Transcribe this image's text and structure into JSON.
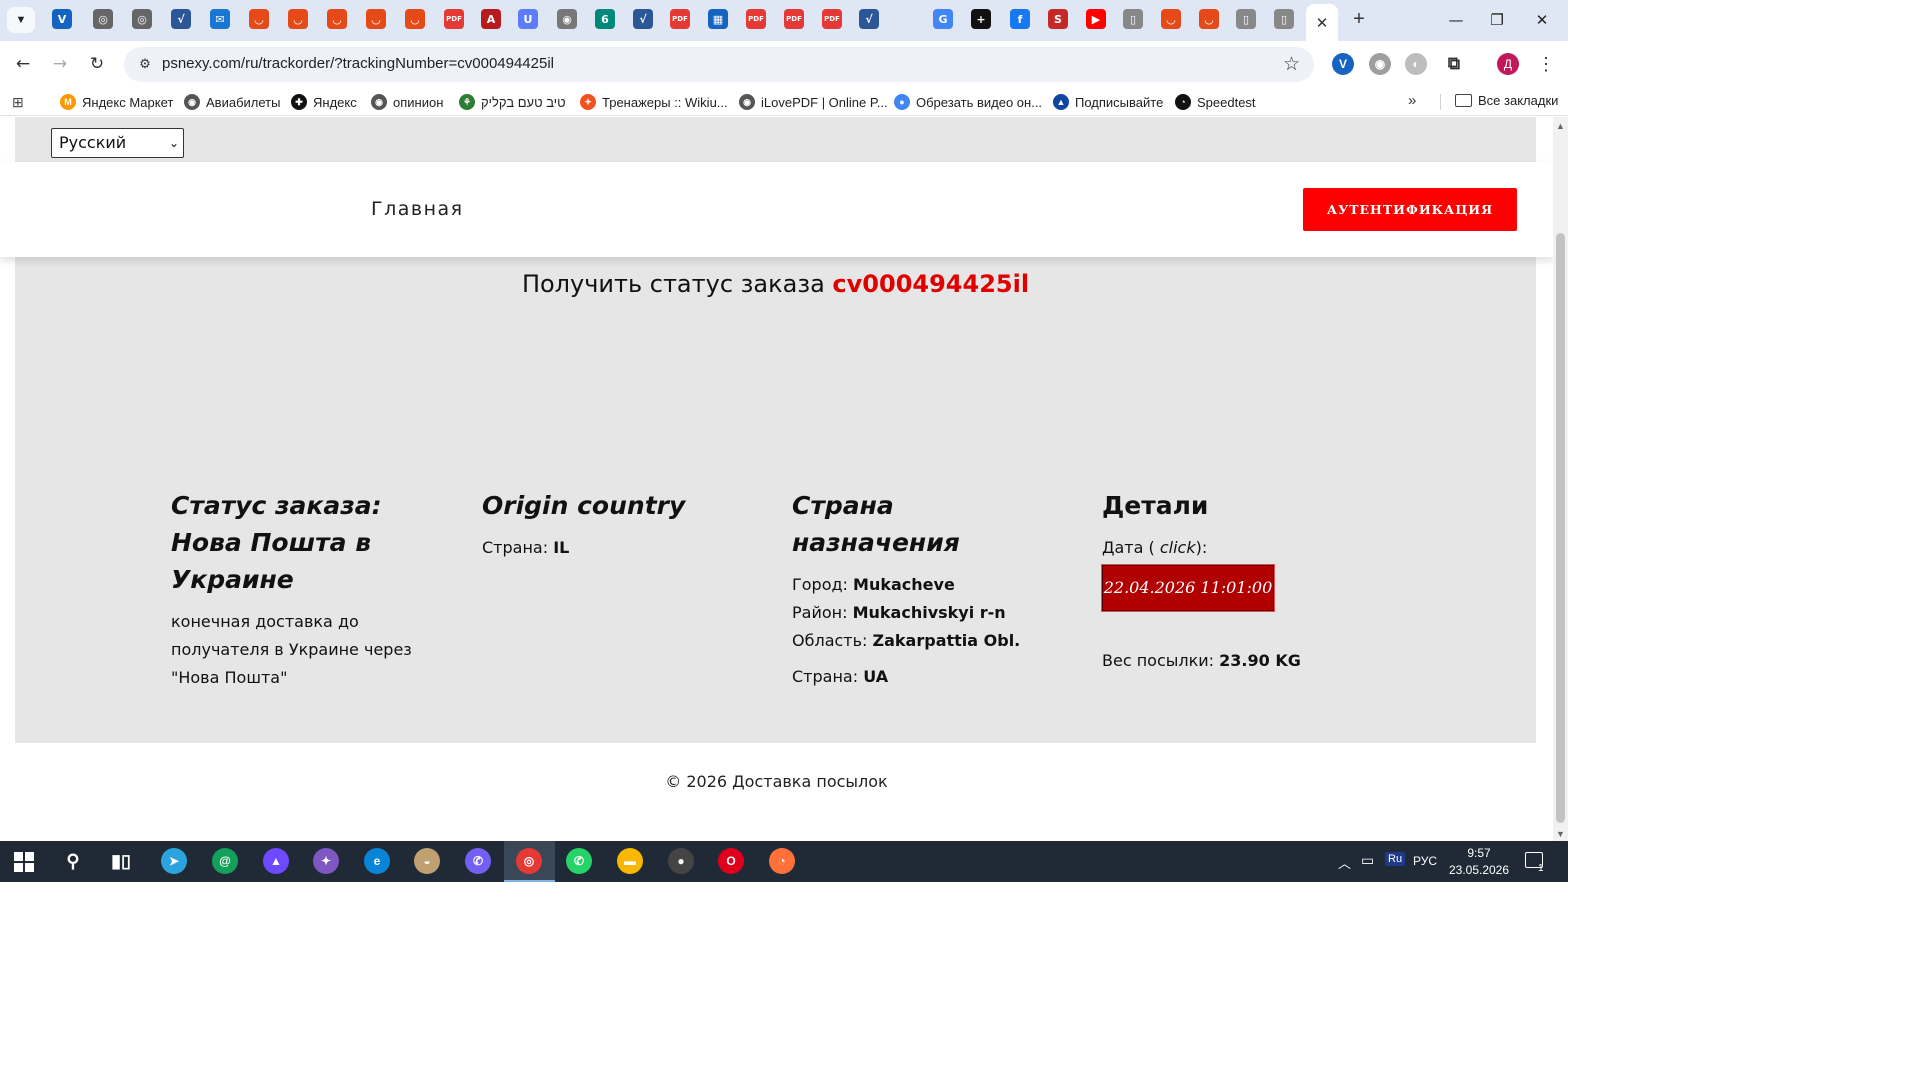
{
  "browser": {
    "url": "psnexy.com/ru/trackorder/?trackingNumber=cv000494425il",
    "active_tab_close": "✕",
    "new_tab": "+",
    "window_controls": {
      "minimize": "—",
      "restore": "❐",
      "close": "✕"
    },
    "tab_icons": [
      {
        "name": "verify-tab-icon",
        "color": "#1565c0",
        "glyph": "V"
      },
      {
        "name": "chrome-tab-icon",
        "color": "#666666",
        "glyph": "◎"
      },
      {
        "name": "chrome-tab-icon-2",
        "color": "#666666",
        "glyph": "◎"
      },
      {
        "name": "check-tab-icon",
        "color": "#2b5797",
        "glyph": "√"
      },
      {
        "name": "mail-tab-icon",
        "color": "#1976d2",
        "glyph": "✉"
      },
      {
        "name": "shield-tab-icon",
        "color": "#e64a19",
        "glyph": "◡"
      },
      {
        "name": "shield-tab-icon-2",
        "color": "#e64a19",
        "glyph": "◡"
      },
      {
        "name": "shield-tab-icon-3",
        "color": "#e64a19",
        "glyph": "◡"
      },
      {
        "name": "shield-tab-icon-4",
        "color": "#e64a19",
        "glyph": "◡"
      },
      {
        "name": "shield-tab-icon-5",
        "color": "#e64a19",
        "glyph": "◡"
      },
      {
        "name": "pdf-tab-icon",
        "color": "#e53935",
        "glyph": "PDF"
      },
      {
        "name": "acrobat-tab-icon",
        "color": "#b71c1c",
        "glyph": "A"
      },
      {
        "name": "u-tab-icon",
        "color": "#5c7cfa",
        "glyph": "U"
      },
      {
        "name": "globe-tab-icon",
        "color": "#777777",
        "glyph": "◉"
      },
      {
        "name": "six-tab-icon",
        "color": "#00897b",
        "glyph": "6"
      },
      {
        "name": "check-tab-icon-2",
        "color": "#2b5797",
        "glyph": "√"
      },
      {
        "name": "pdf-tab-icon-2",
        "color": "#e53935",
        "glyph": "PDF"
      },
      {
        "name": "building-tab-icon",
        "color": "#1565c0",
        "glyph": "▦"
      },
      {
        "name": "pdf-tab-icon-3",
        "color": "#e53935",
        "glyph": "PDF"
      },
      {
        "name": "pdf-tab-icon-4",
        "color": "#e53935",
        "glyph": "PDF"
      },
      {
        "name": "pdf-tab-icon-5",
        "color": "#e53935",
        "glyph": "PDF"
      },
      {
        "name": "check-tab-icon-3",
        "color": "#2b5797",
        "glyph": "√"
      },
      {
        "name": "translate-tab-icon",
        "color": "#4285f4",
        "glyph": "G"
      },
      {
        "name": "plus-tab-icon",
        "color": "#111111",
        "glyph": "+"
      },
      {
        "name": "facebook-tab-icon",
        "color": "#1877f2",
        "glyph": "f"
      },
      {
        "name": "scribd-tab-icon",
        "color": "#c62828",
        "glyph": "S"
      },
      {
        "name": "youtube-tab-icon",
        "color": "#ff0000",
        "glyph": "▶"
      },
      {
        "name": "doc-tab-icon",
        "color": "#888888",
        "glyph": "▯"
      },
      {
        "name": "shield-tab-icon-6",
        "color": "#e64a19",
        "glyph": "◡"
      },
      {
        "name": "shield-tab-icon-7",
        "color": "#e64a19",
        "glyph": "◡"
      },
      {
        "name": "doc-tab-icon-2",
        "color": "#888888",
        "glyph": "▯"
      },
      {
        "name": "doc-tab-icon-3",
        "color": "#888888",
        "glyph": "▯"
      }
    ],
    "profile_initial": "Д",
    "bookmarks": [
      {
        "label": "Яндекс Маркет",
        "color": "#ff9800",
        "glyph": "M"
      },
      {
        "label": "Авиабилеты",
        "color": "#555555",
        "glyph": "◉"
      },
      {
        "label": "Яндекс",
        "color": "#111111",
        "glyph": "✚"
      },
      {
        "label": "опинион",
        "color": "#555555",
        "glyph": "◉"
      },
      {
        "label": "טיב טעם בקליק",
        "color": "#2e7d32",
        "glyph": "⚘"
      },
      {
        "label": "Тренажеры :: Wikiu...",
        "color": "#f4511e",
        "glyph": "✦"
      },
      {
        "label": "iLovePDF | Online P...",
        "color": "#555555",
        "glyph": "◉"
      },
      {
        "label": "Обрезать видео он...",
        "color": "#4285f4",
        "glyph": "●"
      },
      {
        "label": "Подписывайте",
        "color": "#0d47a1",
        "glyph": "▲"
      },
      {
        "label": "Speedtest",
        "color": "#111111",
        "glyph": "◔"
      }
    ],
    "all_bookmarks": "Все закладки"
  },
  "page": {
    "language_select": "Русский",
    "nav_home": "Главная",
    "auth_button": "АУТЕНТИФИКАЦИЯ",
    "status_heading_prefix": "Получить статус заказа ",
    "tracking_number": "cv000494425il",
    "status": {
      "title": "Статус заказа: Нова Пошта в Украине",
      "description": "конечная доставка до получателя в Украине через \"Нова Пошта\""
    },
    "origin": {
      "title": "Origin country",
      "country_label": "Страна: ",
      "country_value": "IL"
    },
    "destination": {
      "title": "Страна назначения",
      "city_label": "Город: ",
      "city_value": "Mukacheve",
      "district_label": "Район: ",
      "district_value": "Mukachivskyi r-n",
      "region_label": "Область: ",
      "region_value": "Zakarpattia Obl.",
      "country_label": "Страна: ",
      "country_value": "UA"
    },
    "details": {
      "title": "Детали",
      "date_label_prefix": "Дата ( ",
      "date_label_click": "click",
      "date_label_suffix": "):",
      "date_value": "22.04.2026 11:01:00",
      "weight_label": "Вес посылки: ",
      "weight_value": "23.90 KG"
    },
    "footer": "© 2026 Доставка посылок",
    "accent_color": "#ff0000",
    "date_button_color": "#b00000"
  },
  "taskbar": {
    "apps": [
      {
        "name": "search-taskbar-icon",
        "color": "transparent",
        "glyph": "⚲"
      },
      {
        "name": "task-view-icon",
        "color": "transparent",
        "glyph": "▮▯"
      },
      {
        "name": "telegram-taskbar-icon",
        "color": "#2aa3df",
        "glyph": "➤"
      },
      {
        "name": "mail-ru-agent-icon",
        "color": "#14a05b",
        "glyph": "@"
      },
      {
        "name": "proton-vpn-icon",
        "color": "#6d4aff",
        "glyph": "▲"
      },
      {
        "name": "copilot-taskbar-icon",
        "color": "#7e57c2",
        "glyph": "✦"
      },
      {
        "name": "edge-taskbar-icon",
        "color": "#0a84d6",
        "glyph": "e"
      },
      {
        "name": "photos-taskbar-icon",
        "color": "#c0a070",
        "glyph": "◒"
      },
      {
        "name": "viber-taskbar-icon",
        "color": "#7360f2",
        "glyph": "✆"
      },
      {
        "name": "chrome-taskbar-icon",
        "color": "#e53935",
        "glyph": "◎"
      },
      {
        "name": "whatsapp-taskbar-icon",
        "color": "#25d366",
        "glyph": "✆"
      },
      {
        "name": "explorer-taskbar-icon",
        "color": "#f9b800",
        "glyph": "▬"
      },
      {
        "name": "recorder-taskbar-icon",
        "color": "#444444",
        "glyph": "●"
      },
      {
        "name": "opera-taskbar-icon",
        "color": "#e0001b",
        "glyph": "O"
      },
      {
        "name": "firefox-taskbar-icon",
        "color": "#ff7139",
        "glyph": "◔"
      }
    ],
    "tray_lang_badge": "Ru",
    "tray_lang": "РУС",
    "time": "9:57",
    "date": "23.05.2026",
    "notifications": "1"
  }
}
